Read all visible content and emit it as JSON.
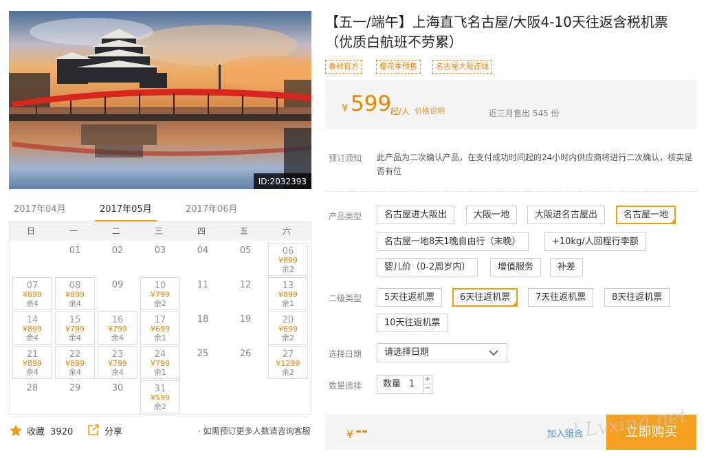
{
  "photo": {
    "id_label": "ID:2032393"
  },
  "months": [
    "2017年04月",
    "2017年05月",
    "2017年06月"
  ],
  "weekdays": [
    "日",
    "一",
    "二",
    "三",
    "四",
    "五",
    "六"
  ],
  "calendar": [
    {
      "day": "01"
    },
    {
      "day": "02"
    },
    {
      "day": "03"
    },
    {
      "day": "04"
    },
    {
      "day": "05"
    },
    {
      "day": "06",
      "price": "¥899",
      "remain": "余2"
    },
    {
      "day": "07",
      "price": "¥899",
      "remain": "余4"
    },
    {
      "day": "08",
      "price": "¥899",
      "remain": "余4"
    },
    {
      "day": "09"
    },
    {
      "day": "10",
      "price": "¥799",
      "remain": "余2"
    },
    {
      "day": "11"
    },
    {
      "day": "12"
    },
    {
      "day": "13",
      "price": "¥899",
      "remain": "余1"
    },
    {
      "day": "14",
      "price": "¥899",
      "remain": "余4"
    },
    {
      "day": "15",
      "price": "¥799",
      "remain": "余4"
    },
    {
      "day": "16",
      "price": "¥799",
      "remain": "余4"
    },
    {
      "day": "17",
      "price": "¥699",
      "remain": "余1"
    },
    {
      "day": "18"
    },
    {
      "day": "19"
    },
    {
      "day": "20",
      "price": "¥699",
      "remain": "余2"
    },
    {
      "day": "21",
      "price": "¥899",
      "remain": "余4"
    },
    {
      "day": "22",
      "price": "¥899",
      "remain": "余4"
    },
    {
      "day": "23",
      "price": "¥799",
      "remain": "余4"
    },
    {
      "day": "24",
      "price": "¥799",
      "remain": "余1"
    },
    {
      "day": "25"
    },
    {
      "day": "26"
    },
    {
      "day": "27",
      "price": "¥1299",
      "remain": "余2"
    },
    {
      "day": "28"
    },
    {
      "day": "29"
    },
    {
      "day": "30"
    },
    {
      "day": "31",
      "price": "¥599",
      "remain": "余2"
    }
  ],
  "footer": {
    "fav_label": "收藏",
    "fav_count": "3920",
    "share_label": "分享",
    "consult": "· 如需预订更多人数请咨询客服"
  },
  "title": "【五一/端午】上海直飞名古屋/大阪4-10天往返含税机票（优质白航班不劳累）",
  "tags": [
    "春秋官方",
    "樱花季预售",
    "名古屋大阪连线"
  ],
  "price": {
    "yen": "¥",
    "amount": "599",
    "unit": "起/人",
    "explain": "价格说明",
    "sold": "近三月售出 545 份"
  },
  "notice": {
    "label": "预订须知",
    "text": "此产品为二次确认产品，在支付成功时间起的24小时内供应商将进行二次确认，核实是否有位"
  },
  "product_type": {
    "label": "产品类型",
    "options": [
      "名古屋进大阪出",
      "大阪一地",
      "大阪进名古屋出",
      "名古屋一地",
      "名古屋一地8天1晚自由行（末晚）",
      "+10kg/人回程行李额",
      "婴儿价（0-2周岁内）",
      "增值服务",
      "补差"
    ],
    "selected": "名古屋一地"
  },
  "sub_type": {
    "label": "二级类型",
    "options": [
      "5天往返机票",
      "6天往返机票",
      "7天往返机票",
      "8天往返机票",
      "10天往返机票"
    ],
    "selected": "6天往返机票"
  },
  "date": {
    "label": "选择日期",
    "value": "请选择日期"
  },
  "quantity": {
    "label": "数量选择",
    "caption": "数量",
    "value": "1",
    "plus": "+",
    "minus": "−"
  },
  "total": {
    "yen": "¥",
    "value": "--",
    "combo_label": "加入组合",
    "buy_label": "立即购买"
  },
  "watermark": "sl.Lvxing.net",
  "colors": {
    "accent": "#f08300",
    "selected_border": "#f39c12",
    "buy_button": "#f5a020",
    "link": "#3c8ad8"
  }
}
